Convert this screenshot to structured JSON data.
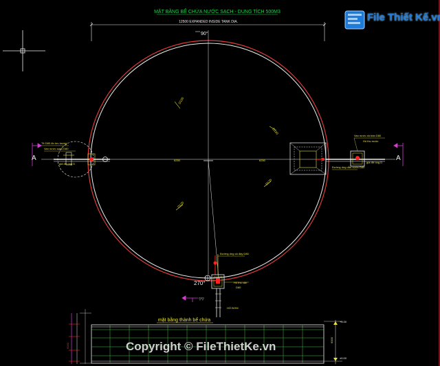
{
  "drawing": {
    "title": "MẶT BẰNG BỂ CHỨA NƯỚC SẠCH - DUNG TÍCH 500M3",
    "top_dimension": "12500 EXPANDED INSIDE TANK DIA.",
    "angle_top": "90°",
    "angle_bottom": "270°",
    "section_mark_left": "A",
    "section_mark_right": "A",
    "section_title": "mặt bằng thành bể chứa",
    "pipe_label_1": "D120",
    "pipe_label_2": "D120",
    "pipe_label_3": "D120",
    "pipe_label_4": "D120",
    "radius_label_left": "6250",
    "radius_label_right": "6250",
    "note_left_1": "Tê D80 đo lưu lượng",
    "note_left_2": "Van nước sạch D80",
    "note_left_3": "giá đỡ ống D",
    "note_right_1": "Van nước xả tràn D80",
    "note_right_2": "Hố thu nước",
    "note_right_3": "Đường ống dẫn nước D80",
    "note_right_4": "giá đỡ ống D",
    "note_bottom_1": "Đường ống xả đáy D80",
    "note_bottom_2": "Hố thu cặn",
    "note_bottom_3": "D80",
    "note_bottom_4": "HỐ BƠM",
    "level_top": "+6.00",
    "level_bottom": "±0.00",
    "dim_side": "6000"
  },
  "watermark": {
    "logo_text": "File Thiết Kế.vn",
    "copyright": "Copyright © FileThietKe.vn"
  },
  "colors": {
    "background": "#000000",
    "title_green": "#21d24a",
    "tank_outer": "#e03c3c",
    "tank_inner": "#f0f0f0",
    "axis": "#f0f0f0",
    "dim_line": "#f0f0f0",
    "label_yellow": "#e8e23a",
    "wall_green": "#3ec63e",
    "wall_magenta": "#d43cd4",
    "accent_red": "#ff2020",
    "logo_blue": "#1f7bd8"
  }
}
